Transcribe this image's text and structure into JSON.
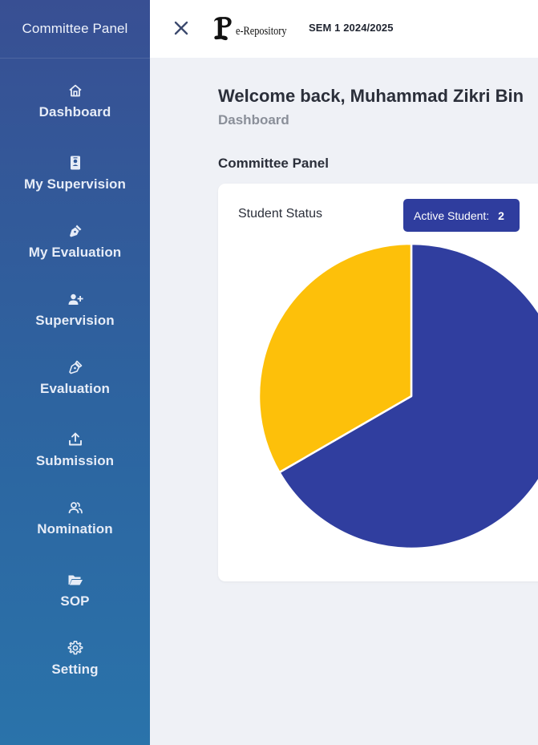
{
  "sidebar": {
    "title": "Committee Panel",
    "items": [
      {
        "label": "Dashboard",
        "icon": "home-icon"
      },
      {
        "label": "My Supervision",
        "icon": "id-badge-icon"
      },
      {
        "label": "My Evaluation",
        "icon": "pen-nib-icon"
      },
      {
        "label": "Supervision",
        "icon": "user-plus-icon"
      },
      {
        "label": "Evaluation",
        "icon": "pen-nib-outline-icon"
      },
      {
        "label": "Submission",
        "icon": "upload-icon"
      },
      {
        "label": "Nomination",
        "icon": "users-icon"
      },
      {
        "label": "SOP",
        "icon": "folder-open-icon"
      },
      {
        "label": "Setting",
        "icon": "gear-icon"
      }
    ]
  },
  "topbar": {
    "close_icon": "close-icon",
    "logo_text": "e-Repository",
    "semester": "SEM 1 2024/2025"
  },
  "main": {
    "welcome": "Welcome back, Muhammad Zikri Bin",
    "breadcrumb": "Dashboard",
    "section_title": "Committee Panel"
  },
  "card": {
    "title": "Student Status",
    "badge_label": "Active Student:",
    "badge_value": "2"
  },
  "colors": {
    "sidebar_top": "#384f93",
    "sidebar_bottom": "#2a73aa",
    "accent": "#2f3d9e",
    "pie_navy": "#303e9f",
    "pie_yellow": "#fdc00a"
  },
  "chart_data": {
    "type": "pie",
    "slices": [
      {
        "value": 2,
        "color": "#303e9f"
      },
      {
        "value": 1,
        "color": "#fdc00a"
      }
    ]
  }
}
